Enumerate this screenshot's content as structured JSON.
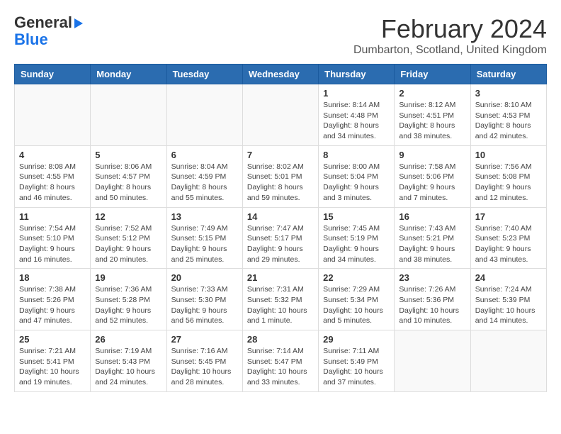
{
  "header": {
    "logo_line1": "General",
    "logo_line2": "Blue",
    "month_title": "February 2024",
    "location": "Dumbarton, Scotland, United Kingdom"
  },
  "days_of_week": [
    "Sunday",
    "Monday",
    "Tuesday",
    "Wednesday",
    "Thursday",
    "Friday",
    "Saturday"
  ],
  "weeks": [
    [
      {
        "day": "",
        "info": ""
      },
      {
        "day": "",
        "info": ""
      },
      {
        "day": "",
        "info": ""
      },
      {
        "day": "",
        "info": ""
      },
      {
        "day": "1",
        "info": "Sunrise: 8:14 AM\nSunset: 4:48 PM\nDaylight: 8 hours\nand 34 minutes."
      },
      {
        "day": "2",
        "info": "Sunrise: 8:12 AM\nSunset: 4:51 PM\nDaylight: 8 hours\nand 38 minutes."
      },
      {
        "day": "3",
        "info": "Sunrise: 8:10 AM\nSunset: 4:53 PM\nDaylight: 8 hours\nand 42 minutes."
      }
    ],
    [
      {
        "day": "4",
        "info": "Sunrise: 8:08 AM\nSunset: 4:55 PM\nDaylight: 8 hours\nand 46 minutes."
      },
      {
        "day": "5",
        "info": "Sunrise: 8:06 AM\nSunset: 4:57 PM\nDaylight: 8 hours\nand 50 minutes."
      },
      {
        "day": "6",
        "info": "Sunrise: 8:04 AM\nSunset: 4:59 PM\nDaylight: 8 hours\nand 55 minutes."
      },
      {
        "day": "7",
        "info": "Sunrise: 8:02 AM\nSunset: 5:01 PM\nDaylight: 8 hours\nand 59 minutes."
      },
      {
        "day": "8",
        "info": "Sunrise: 8:00 AM\nSunset: 5:04 PM\nDaylight: 9 hours\nand 3 minutes."
      },
      {
        "day": "9",
        "info": "Sunrise: 7:58 AM\nSunset: 5:06 PM\nDaylight: 9 hours\nand 7 minutes."
      },
      {
        "day": "10",
        "info": "Sunrise: 7:56 AM\nSunset: 5:08 PM\nDaylight: 9 hours\nand 12 minutes."
      }
    ],
    [
      {
        "day": "11",
        "info": "Sunrise: 7:54 AM\nSunset: 5:10 PM\nDaylight: 9 hours\nand 16 minutes."
      },
      {
        "day": "12",
        "info": "Sunrise: 7:52 AM\nSunset: 5:12 PM\nDaylight: 9 hours\nand 20 minutes."
      },
      {
        "day": "13",
        "info": "Sunrise: 7:49 AM\nSunset: 5:15 PM\nDaylight: 9 hours\nand 25 minutes."
      },
      {
        "day": "14",
        "info": "Sunrise: 7:47 AM\nSunset: 5:17 PM\nDaylight: 9 hours\nand 29 minutes."
      },
      {
        "day": "15",
        "info": "Sunrise: 7:45 AM\nSunset: 5:19 PM\nDaylight: 9 hours\nand 34 minutes."
      },
      {
        "day": "16",
        "info": "Sunrise: 7:43 AM\nSunset: 5:21 PM\nDaylight: 9 hours\nand 38 minutes."
      },
      {
        "day": "17",
        "info": "Sunrise: 7:40 AM\nSunset: 5:23 PM\nDaylight: 9 hours\nand 43 minutes."
      }
    ],
    [
      {
        "day": "18",
        "info": "Sunrise: 7:38 AM\nSunset: 5:26 PM\nDaylight: 9 hours\nand 47 minutes."
      },
      {
        "day": "19",
        "info": "Sunrise: 7:36 AM\nSunset: 5:28 PM\nDaylight: 9 hours\nand 52 minutes."
      },
      {
        "day": "20",
        "info": "Sunrise: 7:33 AM\nSunset: 5:30 PM\nDaylight: 9 hours\nand 56 minutes."
      },
      {
        "day": "21",
        "info": "Sunrise: 7:31 AM\nSunset: 5:32 PM\nDaylight: 10 hours\nand 1 minute."
      },
      {
        "day": "22",
        "info": "Sunrise: 7:29 AM\nSunset: 5:34 PM\nDaylight: 10 hours\nand 5 minutes."
      },
      {
        "day": "23",
        "info": "Sunrise: 7:26 AM\nSunset: 5:36 PM\nDaylight: 10 hours\nand 10 minutes."
      },
      {
        "day": "24",
        "info": "Sunrise: 7:24 AM\nSunset: 5:39 PM\nDaylight: 10 hours\nand 14 minutes."
      }
    ],
    [
      {
        "day": "25",
        "info": "Sunrise: 7:21 AM\nSunset: 5:41 PM\nDaylight: 10 hours\nand 19 minutes."
      },
      {
        "day": "26",
        "info": "Sunrise: 7:19 AM\nSunset: 5:43 PM\nDaylight: 10 hours\nand 24 minutes."
      },
      {
        "day": "27",
        "info": "Sunrise: 7:16 AM\nSunset: 5:45 PM\nDaylight: 10 hours\nand 28 minutes."
      },
      {
        "day": "28",
        "info": "Sunrise: 7:14 AM\nSunset: 5:47 PM\nDaylight: 10 hours\nand 33 minutes."
      },
      {
        "day": "29",
        "info": "Sunrise: 7:11 AM\nSunset: 5:49 PM\nDaylight: 10 hours\nand 37 minutes."
      },
      {
        "day": "",
        "info": ""
      },
      {
        "day": "",
        "info": ""
      }
    ]
  ]
}
